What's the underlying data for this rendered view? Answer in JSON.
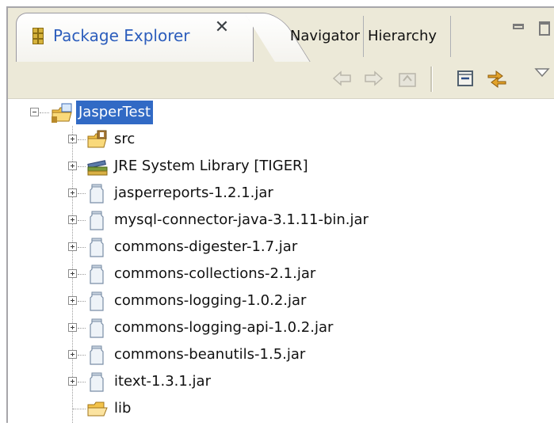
{
  "tabs": {
    "active": {
      "label": "Package Explorer",
      "close_glyph": "✕"
    },
    "others": [
      "Navigator",
      "Hierarchy"
    ]
  },
  "toolbar": {
    "buttons": [
      "back-icon",
      "forward-icon",
      "up-icon",
      "collapse-all-icon",
      "link-with-editor-icon",
      "view-menu-icon"
    ]
  },
  "tree": {
    "project": {
      "label": "JasperTest",
      "expanded": true,
      "selected": true,
      "icon": "java-project-icon"
    },
    "children": [
      {
        "label": "src",
        "icon": "source-folder-icon",
        "expandable": true
      },
      {
        "label": "JRE System Library [TIGER]",
        "icon": "library-icon",
        "expandable": true
      },
      {
        "label": "jasperreports-1.2.1.jar",
        "icon": "jar-icon",
        "expandable": true
      },
      {
        "label": "mysql-connector-java-3.1.11-bin.jar",
        "icon": "jar-icon",
        "expandable": true
      },
      {
        "label": "commons-digester-1.7.jar",
        "icon": "jar-icon",
        "expandable": true
      },
      {
        "label": "commons-collections-2.1.jar",
        "icon": "jar-icon",
        "expandable": true
      },
      {
        "label": "commons-logging-1.0.2.jar",
        "icon": "jar-icon",
        "expandable": true
      },
      {
        "label": "commons-logging-api-1.0.2.jar",
        "icon": "jar-icon",
        "expandable": true
      },
      {
        "label": "commons-beanutils-1.5.jar",
        "icon": "jar-icon",
        "expandable": true
      },
      {
        "label": "itext-1.3.1.jar",
        "icon": "jar-icon",
        "expandable": true
      },
      {
        "label": "lib",
        "icon": "folder-icon",
        "expandable": false
      }
    ]
  },
  "colors": {
    "selection": "#316ac5",
    "tab_title": "#2c5dbc",
    "chrome": "#ece9d8"
  }
}
